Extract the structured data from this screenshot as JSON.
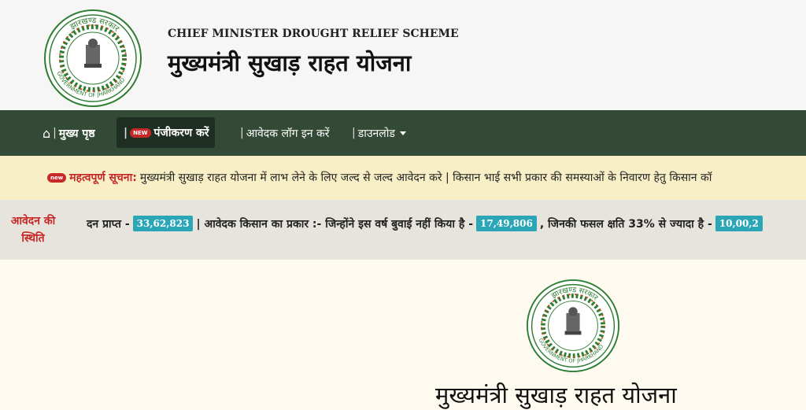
{
  "header": {
    "title_en": "CHIEF MINISTER DROUGHT RELIEF SCHEME",
    "title_hi": "मुख्यमंत्री सुखाड़ राहत योजना",
    "seal_top_text": "झारखण्ड सरकार",
    "seal_bottom_text": "GOVERNMENT OF JHARKHAND"
  },
  "nav": {
    "home_label": "मुख्य पृष्ठ",
    "register_label": "पंजीकरण करें",
    "register_badge": "NEW",
    "login_label": "आवेदक लॉग इन करें",
    "download_label": "डाउनलोड"
  },
  "notice": {
    "badge": "new",
    "label": "महत्वपूर्ण सूचना:",
    "text": "मुख्यमंत्री सुखाड़ राहत योजना में लाभ लेने के लिए जल्द से जल्द आवेदन करे | किसान भाई सभी प्रकार की समस्याओं के निवारण हेतु किसान कॉ"
  },
  "status": {
    "label": "आवेदन की स्थिति",
    "received_label": "दन प्राप्त -",
    "received_count": "33,62,823",
    "type_label": "| आवेदक किसान का प्रकार :- जिन्होंने इस वर्ष बुवाई नहीं किया है -",
    "no_sowing_count": "17,49,806",
    "loss_label": ", जिनकी फसल क्षति 33% से ज्यादा है -",
    "loss_count": "10,00,2"
  },
  "content": {
    "heading": "मुख्यमंत्री सुखाड़ राहत योजना"
  },
  "colors": {
    "navbar": "#324a36",
    "notice_bg": "#f8efc6",
    "badge": "#2aa6b7",
    "alert_red": "#c62828"
  }
}
